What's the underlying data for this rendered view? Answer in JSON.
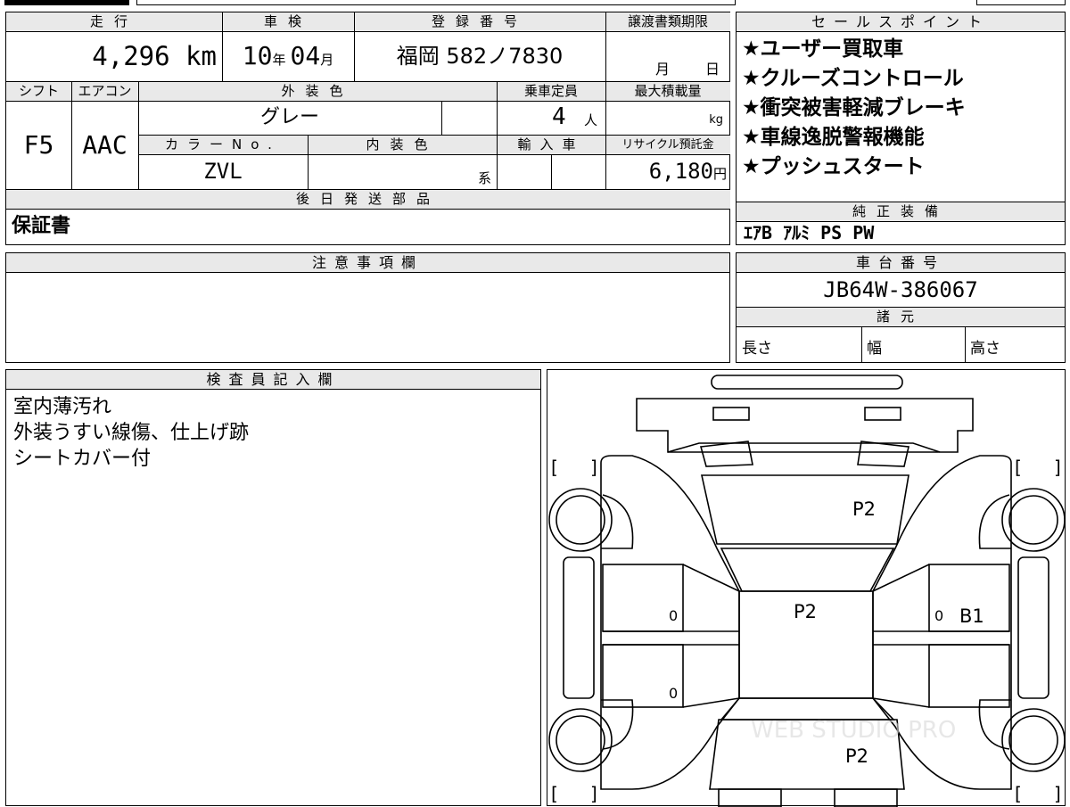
{
  "vehicle": {
    "labels": {
      "mileage": "走行",
      "inspection": "車検",
      "registration": "登録番号",
      "transfer_deadline": "譲渡書類期限",
      "shift": "シフト",
      "aircon": "エアコン",
      "exterior_color": "外装色",
      "capacity": "乗車定員",
      "max_load": "最大積載量",
      "color_no": "カラーNo.",
      "interior_color": "内装色",
      "import": "輸入車",
      "recycle_fee": "リサイクル預託金"
    },
    "mileage_value": "4,296",
    "mileage_unit": "km",
    "inspection_year": "10",
    "inspection_year_unit": "年",
    "inspection_month": "04",
    "inspection_month_unit": "月",
    "plate": "福岡 582ノ7830",
    "deadline_month_unit": "月",
    "deadline_day_unit": "日",
    "shift_value": "F5",
    "aircon_value": "AAC",
    "exterior_color_value": "グレー",
    "capacity_value": "4",
    "capacity_unit": "人",
    "max_load_unit": "kg",
    "color_no_value": "ZVL",
    "interior_color_unit": "系",
    "recycle_value": "6,180",
    "recycle_unit": "円"
  },
  "later_parts": {
    "header": "後日発送部品",
    "value": "保証書"
  },
  "sales_points": {
    "header": "セールスポイント",
    "items": [
      "★ユーザー買取車",
      "★クルーズコントロール",
      "★衝突被害軽減ブレーキ",
      "★車線逸脱警報機能",
      "★プッシュスタート"
    ]
  },
  "genuine_equipment": {
    "header": "純正装備",
    "value": "ｴｱB ｱﾙﾐ PS PW"
  },
  "notes": {
    "header": "注意事項欄"
  },
  "chassis": {
    "header": "車台番号",
    "value": "JB64W-386067"
  },
  "specs": {
    "header": "諸元",
    "length_label": "長さ",
    "width_label": "幅",
    "height_label": "高さ"
  },
  "inspector": {
    "header": "検査員記入欄",
    "lines": [
      "室内薄汚れ",
      "外装うすい線傷、仕上げ跡",
      "シートカバー付"
    ]
  },
  "diagram": {
    "marks": {
      "hood": "P2",
      "roof": "P2",
      "rear": "P2",
      "front_right_door_code": "B1",
      "zero_left_front": "0",
      "zero_left_rear": "0",
      "zero_right_front": "0"
    },
    "bracket_open": "[",
    "bracket_close": "]",
    "watermark": "WEB STUDIO PRO"
  }
}
